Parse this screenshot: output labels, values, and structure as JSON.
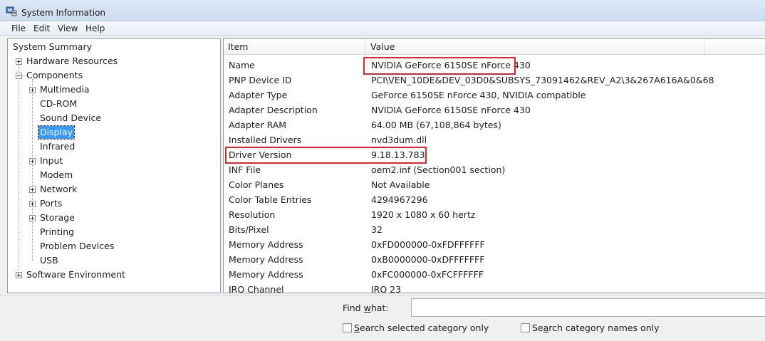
{
  "window": {
    "title": "System Information",
    "icon": "system-information-icon"
  },
  "menu": [
    "File",
    "Edit",
    "View",
    "Help"
  ],
  "tree": [
    {
      "label": "System Summary",
      "level": 0,
      "expander": "none"
    },
    {
      "label": "Hardware Resources",
      "level": 0,
      "expander": "plus"
    },
    {
      "label": "Components",
      "level": 0,
      "expander": "minus"
    },
    {
      "label": "Multimedia",
      "level": 1,
      "expander": "plus"
    },
    {
      "label": "CD-ROM",
      "level": 1,
      "expander": "none"
    },
    {
      "label": "Sound Device",
      "level": 1,
      "expander": "none"
    },
    {
      "label": "Display",
      "level": 1,
      "expander": "none",
      "selected": true
    },
    {
      "label": "Infrared",
      "level": 1,
      "expander": "none"
    },
    {
      "label": "Input",
      "level": 1,
      "expander": "plus"
    },
    {
      "label": "Modem",
      "level": 1,
      "expander": "none"
    },
    {
      "label": "Network",
      "level": 1,
      "expander": "plus"
    },
    {
      "label": "Ports",
      "level": 1,
      "expander": "plus"
    },
    {
      "label": "Storage",
      "level": 1,
      "expander": "plus"
    },
    {
      "label": "Printing",
      "level": 1,
      "expander": "none"
    },
    {
      "label": "Problem Devices",
      "level": 1,
      "expander": "none"
    },
    {
      "label": "USB",
      "level": 1,
      "expander": "none"
    },
    {
      "label": "Software Environment",
      "level": 0,
      "expander": "plus"
    }
  ],
  "list": {
    "columns": [
      "Item",
      "Value"
    ],
    "rows": [
      {
        "item": "Name",
        "value": "NVIDIA GeForce 6150SE nForce 430"
      },
      {
        "item": "PNP Device ID",
        "value": "PCI\\VEN_10DE&DEV_03D0&SUBSYS_73091462&REV_A2\\3&267A616A&0&68"
      },
      {
        "item": "Adapter Type",
        "value": "GeForce 6150SE nForce 430, NVIDIA compatible"
      },
      {
        "item": "Adapter Description",
        "value": "NVIDIA GeForce 6150SE nForce 430"
      },
      {
        "item": "Adapter RAM",
        "value": "64.00 MB (67,108,864 bytes)"
      },
      {
        "item": "Installed Drivers",
        "value": "nvd3dum.dll"
      },
      {
        "item": "Driver Version",
        "value": "9.18.13.783"
      },
      {
        "item": "INF File",
        "value": "oem2.inf (Section001 section)"
      },
      {
        "item": "Color Planes",
        "value": "Not Available"
      },
      {
        "item": "Color Table Entries",
        "value": "4294967296"
      },
      {
        "item": "Resolution",
        "value": "1920 x 1080 x 60 hertz"
      },
      {
        "item": "Bits/Pixel",
        "value": "32"
      },
      {
        "item": "Memory Address",
        "value": "0xFD000000-0xFDFFFFFF"
      },
      {
        "item": "Memory Address",
        "value": "0xB0000000-0xDFFFFFFF"
      },
      {
        "item": "Memory Address",
        "value": "0xFC000000-0xFCFFFFFF"
      },
      {
        "item": "IRQ Channel",
        "value": "IRQ 23"
      }
    ]
  },
  "find": {
    "label_pre": "Find ",
    "label_underlined": "w",
    "label_post": "hat:",
    "value": ""
  },
  "options": {
    "search_selected": {
      "underlined": "S",
      "rest": "earch selected category only",
      "checked": false
    },
    "search_names": {
      "pre": "Se",
      "underlined": "a",
      "rest": "rch category names only",
      "checked": false
    }
  },
  "colors": {
    "highlight_box": "#e0262b",
    "selection": "#3399ff"
  }
}
